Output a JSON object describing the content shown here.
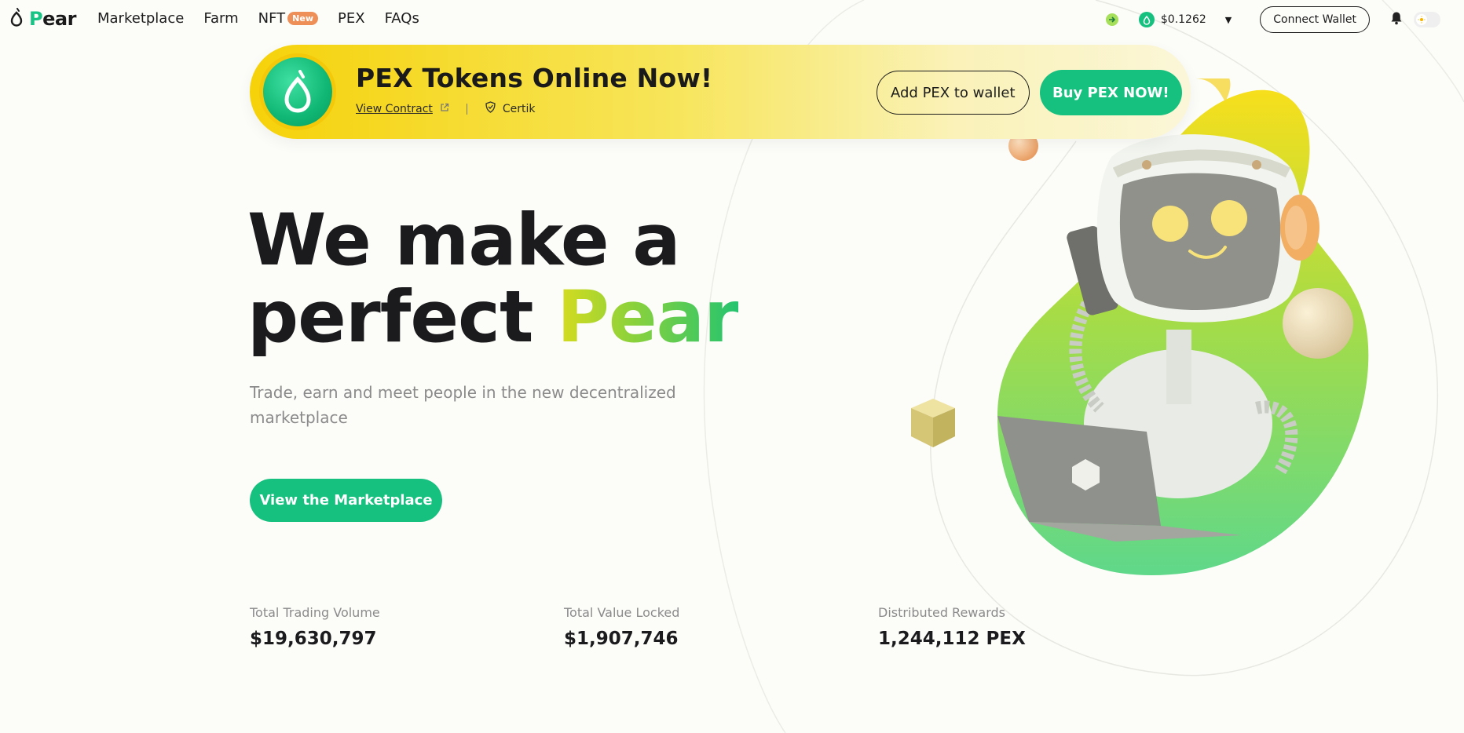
{
  "nav": {
    "logo_letter": "P",
    "logo_rest": "ear",
    "links": [
      {
        "label": "Marketplace"
      },
      {
        "label": "Farm"
      },
      {
        "label": "NFT",
        "badge": "New"
      },
      {
        "label": "PEX"
      },
      {
        "label": "FAQs"
      }
    ],
    "token_price": "$0.1262",
    "connect_label": "Connect Wallet"
  },
  "banner": {
    "title": "PEX Tokens Online Now!",
    "view_contract": "View Contract",
    "certik": "Certik",
    "add_button": "Add PEX to wallet",
    "buy_button": "Buy PEX NOW!"
  },
  "hero": {
    "line1": "We make a",
    "line2_prefix": "perfect ",
    "line2_highlight": "Pear",
    "subhead": "Trade, earn and meet people in the new decentralized marketplace",
    "cta": "View the Marketplace"
  },
  "stats": [
    {
      "label": "Total Trading Volume",
      "value": "$19,630,797"
    },
    {
      "label": "Total Value Locked",
      "value": "$1,907,746"
    },
    {
      "label": "Distributed Rewards",
      "value": "1,244,112 PEX"
    }
  ],
  "colors": {
    "brand_green": "#16c07f",
    "banner_yellow": "#f6d20a",
    "new_badge": "#ee8f57",
    "text_dark": "#1b1b1e",
    "text_muted": "#8b8b8b"
  },
  "icons": {
    "logo": "pear-drop-icon",
    "price_arrow": "arrow-right-icon",
    "token": "pex-token-icon",
    "caret": "chevron-down-icon",
    "bell": "bell-icon",
    "theme": "sun-icon",
    "external": "external-link-icon",
    "certik": "shield-icon"
  }
}
